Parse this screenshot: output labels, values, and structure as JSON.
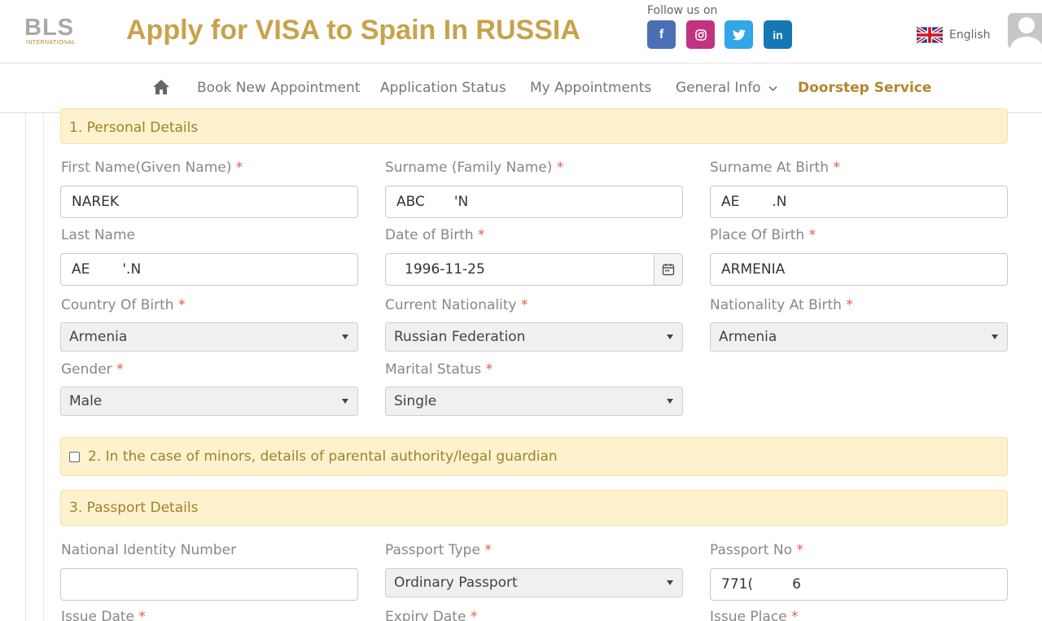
{
  "header": {
    "logo_main": "BLS",
    "logo_sub": "INTERNATIONAL",
    "title": "Apply for VISA to Spain In RUSSIA",
    "follow_text": "Follow us on",
    "social": [
      {
        "name": "facebook",
        "glyph": "f",
        "color": "#4a6fb5"
      },
      {
        "name": "instagram",
        "glyph": "◎",
        "color": "#c1337f"
      },
      {
        "name": "twitter",
        "glyph": "🐦",
        "color": "#32a6e6"
      },
      {
        "name": "linkedin",
        "glyph": "in",
        "color": "#1578b4"
      }
    ],
    "language": "English"
  },
  "nav": {
    "items": [
      "Book New Appointment",
      "Application Status",
      "My Appointments",
      "General Info",
      "Doorstep Service"
    ]
  },
  "sections": {
    "personal": "1. Personal Details",
    "minors": "2. In the case of minors, details of parental authority/legal guardian",
    "passport": "3. Passport Details"
  },
  "fields": {
    "first_name_label": "First Name(Given Name)",
    "first_name_value": "NAREK",
    "surname_label": "Surname (Family Name)",
    "surname_value_a": "ABC",
    "surname_value_b": "'N",
    "surname_birth_label": "Surname At Birth",
    "surname_birth_value_a": "AE",
    "surname_birth_value_b": ".N",
    "last_name_label": "Last Name",
    "last_name_value_a": "AE",
    "last_name_value_b": "'.N",
    "dob_label": "Date of Birth",
    "dob_value": "1996-11-25",
    "pob_label": "Place Of Birth",
    "pob_value": "ARMENIA",
    "country_birth_label": "Country Of Birth",
    "country_birth_value": "Armenia",
    "nationality_label": "Current Nationality",
    "nationality_value": "Russian Federation",
    "nationality_birth_label": "Nationality At Birth",
    "nationality_birth_value": "Armenia",
    "gender_label": "Gender",
    "gender_value": "Male",
    "marital_label": "Marital Status",
    "marital_value": "Single",
    "nid_label": "National Identity Number",
    "nid_value": "",
    "passport_type_label": "Passport Type",
    "passport_type_value": "Ordinary Passport",
    "passport_no_label": "Passport No",
    "passport_no_value_a": "771(",
    "passport_no_value_b": "6",
    "issue_date_label": "Issue Date",
    "expiry_date_label": "Expiry Date",
    "issue_place_label": "Issue Place",
    "required_mark": "*"
  }
}
